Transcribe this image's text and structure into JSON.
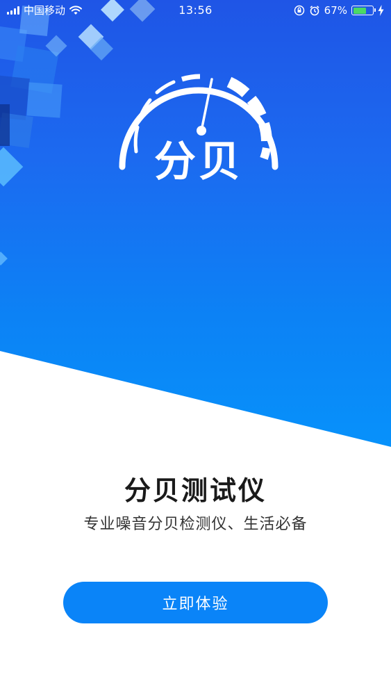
{
  "status_bar": {
    "carrier": "中国移动",
    "time": "13:56",
    "battery_percent": "67%",
    "battery_level": 0.67,
    "icons": [
      "signal-icon",
      "wifi-icon",
      "screen-lock-icon",
      "alarm-icon",
      "battery-icon",
      "charging-icon"
    ]
  },
  "logo": {
    "text": "分贝",
    "icon": "speedometer-gauge-icon"
  },
  "main": {
    "title": "分贝测试仪",
    "subtitle": "专业噪音分贝检测仪、生活必备",
    "cta_label": "立即体验"
  },
  "colors": {
    "primary_blue": "#1f55e6",
    "gradient_end": "#0792fb",
    "button": "#0a84f8",
    "battery_fill": "#4cd964"
  }
}
